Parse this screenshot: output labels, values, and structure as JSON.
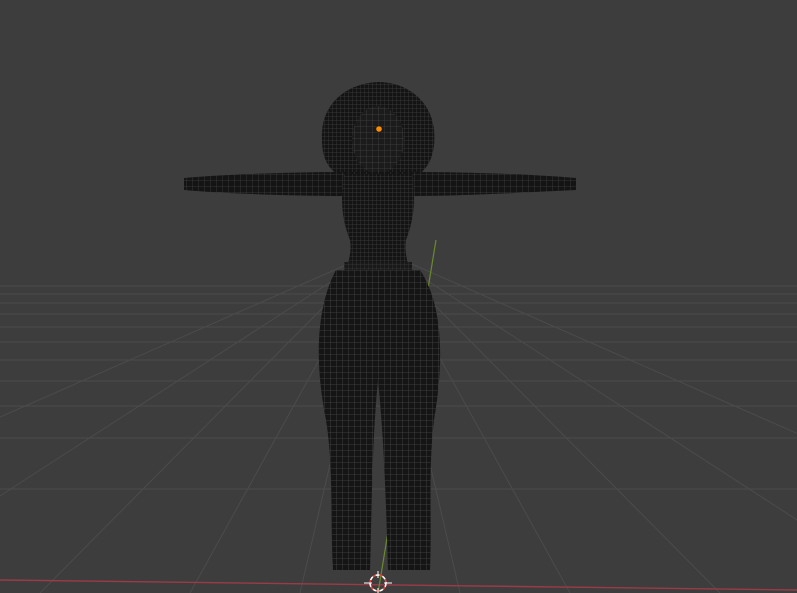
{
  "viewport": {
    "background_color": "#3d3d3d",
    "grid_line_color": "#4b4b4b",
    "x_axis_color": "#9a3b47",
    "y_axis_color": "#6b8a2c",
    "mesh_fill_color": "#141414",
    "wire_color": "#4a4a4a",
    "origin_dot_color": "#ff8c00",
    "cursor_color": "#ffffff",
    "cursor_accent_color": "#ff3b3b"
  },
  "scene": {
    "object": "character-mesh-wireframe",
    "pose": "T-pose",
    "icons": [
      "object-origin-icon",
      "3d-cursor-icon"
    ]
  }
}
